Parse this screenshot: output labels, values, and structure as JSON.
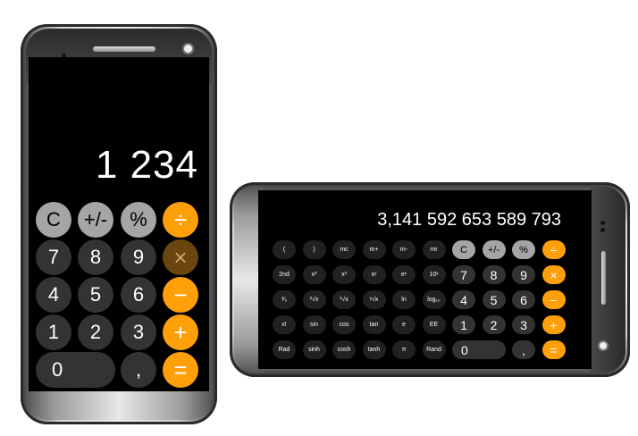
{
  "portrait": {
    "display": "1 234",
    "keys": [
      "C",
      "+/-",
      "%",
      "÷",
      "7",
      "8",
      "9",
      "×",
      "4",
      "5",
      "6",
      "−",
      "1",
      "2",
      "3",
      "+",
      "0",
      ",",
      "="
    ]
  },
  "landscape": {
    "display": "3,141 592 653 589 793",
    "keys": [
      "(",
      ")",
      "mc",
      "m+",
      "m-",
      "mr",
      "C",
      "+/-",
      "%",
      "÷",
      "2nd",
      "x²",
      "x³",
      "xʸ",
      "eˣ",
      "10ˣ",
      "7",
      "8",
      "9",
      "×",
      "¹⁄ₓ",
      "²√x",
      "³√x",
      "ʸ√x",
      "ln",
      "log₁₀",
      "4",
      "5",
      "6",
      "−",
      "x!",
      "sin",
      "cos",
      "tan",
      "e",
      "EE",
      "1",
      "2",
      "3",
      "+",
      "Rad",
      "sinh",
      "cosh",
      "tanh",
      "π",
      "Rand",
      "0",
      ",",
      "="
    ]
  },
  "colors": {
    "orange": "#ff9f0a",
    "dark_key": "#333333",
    "light_key": "#a5a5a5",
    "screen": "#000000"
  }
}
